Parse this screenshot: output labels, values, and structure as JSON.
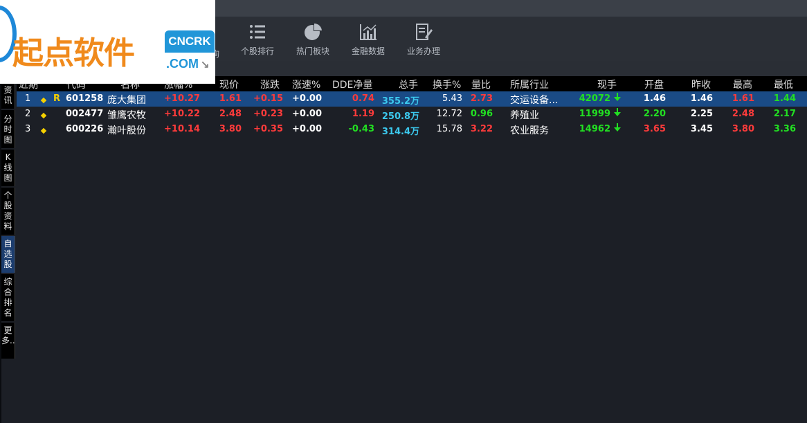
{
  "logo": {
    "brand": "起点软件",
    "badge_top": "CNCRK",
    "badge_bottom": ".COM"
  },
  "toolbar": {
    "partial_label": "询",
    "items": [
      {
        "label": "个股排行",
        "icon": "list-icon"
      },
      {
        "label": "热门板块",
        "icon": "pie-chart-icon"
      },
      {
        "label": "金融数据",
        "icon": "bar-chart-icon"
      },
      {
        "label": "业务办理",
        "icon": "document-edit-icon"
      }
    ]
  },
  "sidetabs": [
    "资讯",
    "分时图",
    "K线图",
    "个股资料",
    "自选股",
    "综合排名",
    "更多.."
  ],
  "table": {
    "headers": {
      "col0": "近",
      "col0b": "期",
      "code": "代码",
      "name": "名称",
      "pct": "涨幅%",
      "price": "现价",
      "change": "涨跌",
      "speed": "涨速%",
      "dde": "DDE净量",
      "volume": "总手",
      "turnover": "换手%",
      "ratio": "量比",
      "industry": "所属行业",
      "cur": "现手",
      "open": "开盘",
      "prev": "昨收",
      "high": "最高",
      "low": "最低"
    },
    "rows": [
      {
        "idx": "1",
        "flag": "R",
        "code": "601258",
        "name": "庞大集团",
        "pct": "+10.27",
        "price": "1.61",
        "change": "+0.15",
        "speed": "+0.00",
        "dde": "0.74",
        "volume": "355.2万",
        "turnover": "5.43",
        "ratio": "2.73",
        "industry": "交运设备...",
        "cur": "42072",
        "open": "1.46",
        "prev": "1.46",
        "high": "1.61",
        "low": "1.44"
      },
      {
        "idx": "2",
        "flag": "",
        "code": "002477",
        "name": "雏鹰农牧",
        "pct": "+10.22",
        "price": "2.48",
        "change": "+0.23",
        "speed": "+0.00",
        "dde": "1.19",
        "volume": "250.8万",
        "turnover": "12.72",
        "ratio": "0.96",
        "industry": "养殖业",
        "cur": "11999",
        "open": "2.20",
        "prev": "2.25",
        "high": "2.48",
        "low": "2.17"
      },
      {
        "idx": "3",
        "flag": "",
        "code": "600226",
        "name": "瀚叶股份",
        "pct": "+10.14",
        "price": "3.80",
        "change": "+0.35",
        "speed": "+0.00",
        "dde": "-0.43",
        "volume": "314.4万",
        "turnover": "15.78",
        "ratio": "3.22",
        "industry": "农业服务",
        "cur": "14962",
        "open": "3.65",
        "prev": "3.45",
        "high": "3.80",
        "low": "3.36"
      }
    ]
  },
  "colors": {
    "up": "#ff3b3b",
    "down": "#22e022",
    "accent": "#3cc9ee",
    "selected": "#1a4b86"
  }
}
